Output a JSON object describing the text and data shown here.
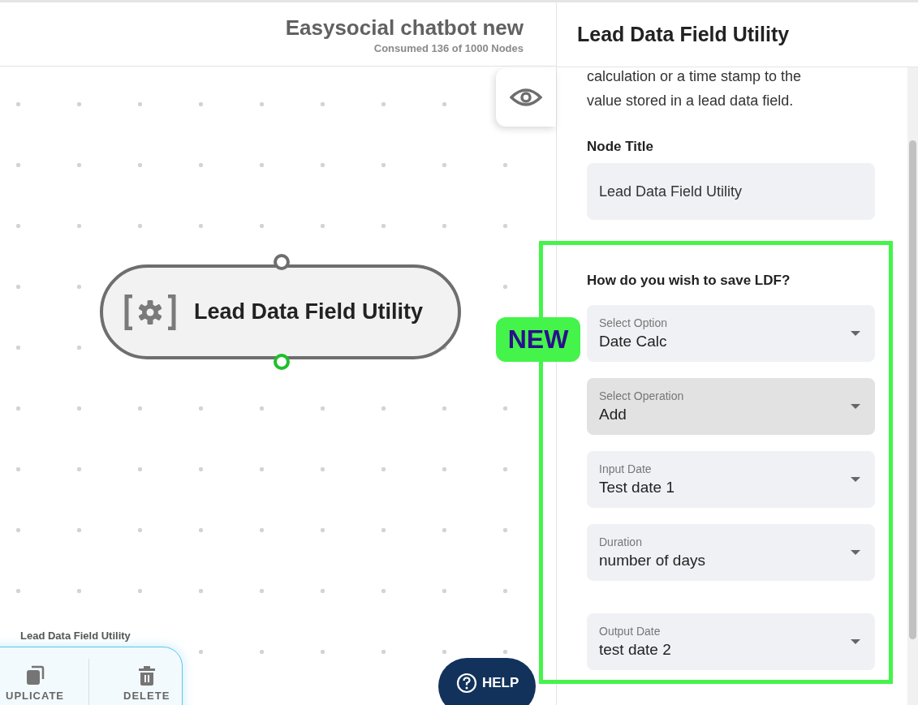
{
  "header": {
    "title": "Easysocial chatbot new",
    "subtitle": "Consumed 136 of 1000 Nodes"
  },
  "canvas": {
    "node": {
      "title": "Lead Data Field Utility"
    },
    "toolbar": {
      "label": "Lead Data Field Utility",
      "actions": [
        {
          "label": "UPLICATE",
          "kind": "duplicate"
        },
        {
          "label": "DELETE",
          "kind": "delete"
        }
      ]
    },
    "help": "HELP"
  },
  "badge": "NEW",
  "panel": {
    "title": "Lead Data Field Utility",
    "description_lines": [
      "calculation or a time stamp to the",
      "value stored in a lead data field."
    ],
    "node_title": {
      "label": "Node Title",
      "value": "Lead Data Field Utility"
    },
    "section": "How do you wish to save LDF?",
    "fields": [
      {
        "label": "Select Option",
        "value": "Date Calc",
        "highlighted": false
      },
      {
        "label": "Select Operation",
        "value": "Add",
        "highlighted": true
      },
      {
        "label": "Input Date",
        "value": "Test date 1",
        "highlighted": false
      },
      {
        "label": "Duration",
        "value": "number of days",
        "highlighted": false
      },
      {
        "label": "Output Date",
        "value": "test date 2",
        "highlighted": false
      }
    ]
  }
}
